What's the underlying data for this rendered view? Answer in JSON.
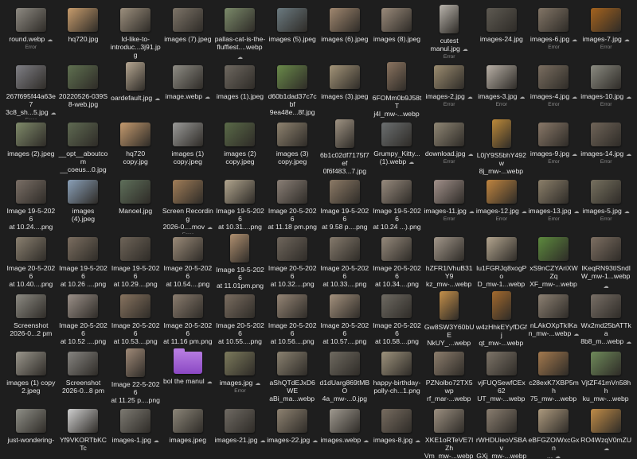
{
  "files": [
    {
      "name": "round.webp",
      "status": "Error",
      "thumb": "#8e8a82",
      "cloud": true
    },
    {
      "name": "hq720.jpg",
      "status": "",
      "thumb": "#c79c6c",
      "cloud": false
    },
    {
      "name": "Id-like-to-\nintroduc...3j91.jpg",
      "status": "",
      "thumb": "#9c8f7d",
      "cloud": false
    },
    {
      "name": "images (7).jpeg",
      "status": "",
      "thumb": "#7d7468",
      "cloud": false
    },
    {
      "name": "pallas-cat-is-the-\nfluffiest....webp",
      "status": "",
      "thumb": "#7b8a6a",
      "cloud": true
    },
    {
      "name": "images (5).jpeg",
      "status": "",
      "thumb": "#6b7a80",
      "cloud": false
    },
    {
      "name": "images (6).jpeg",
      "status": "",
      "thumb": "#a0876f",
      "cloud": false
    },
    {
      "name": "images (8).jpeg",
      "status": "",
      "thumb": "#9a8a7a",
      "cloud": false
    },
    {
      "name": "cutest\nmanul.jpg",
      "status": "Error",
      "thumb": "#b9b4ac",
      "cloud": true,
      "tall": true
    },
    {
      "name": "images-24.jpg",
      "status": "",
      "thumb": "#5e5a52",
      "cloud": false
    },
    {
      "name": "images-6.jpg",
      "status": "Error",
      "thumb": "#827566",
      "cloud": true
    },
    {
      "name": "images-7.jpg",
      "status": "Error",
      "thumb": "#a5631e",
      "cloud": true
    },
    {
      "name": "267f695f44a63e7\n3c8_sh...5.jpg",
      "status": "Error",
      "thumb": "#7f7f85",
      "cloud": true
    },
    {
      "name": "20220526-039S\n8-web.jpg",
      "status": "",
      "thumb": "#5f7050",
      "cloud": false
    },
    {
      "name": "oardefault.jpg",
      "status": "",
      "thumb": "#b6a792",
      "cloud": true,
      "tall": true
    },
    {
      "name": "image.webp",
      "status": "",
      "thumb": "#8e8c84",
      "cloud": true
    },
    {
      "name": "images (1).jpeg",
      "status": "",
      "thumb": "#6e6860",
      "cloud": false
    },
    {
      "name": "d60b1dad37c7cbf\n9ea48e...8f.jpg",
      "status": "",
      "thumb": "#6a8a4a",
      "cloud": false
    },
    {
      "name": "images (3).jpeg",
      "status": "",
      "thumb": "#a39478",
      "cloud": false
    },
    {
      "name": "6FOMm0b9J58tT\nj4l_mw-...webp",
      "status": "Error",
      "thumb": "#8b7460",
      "cloud": true,
      "tall": true
    },
    {
      "name": "images-2.jpg",
      "status": "Error",
      "thumb": "#9b8c70",
      "cloud": true
    },
    {
      "name": "images-3.jpg",
      "status": "Error",
      "thumb": "#b8b0a6",
      "cloud": true
    },
    {
      "name": "images-4.jpg",
      "status": "Error",
      "thumb": "#7a6e60",
      "cloud": true
    },
    {
      "name": "images-10.jpg",
      "status": "Error",
      "thumb": "#8a8a80",
      "cloud": true
    },
    {
      "name": "images (2).jpeg",
      "status": "",
      "thumb": "#7f8a6a",
      "cloud": false
    },
    {
      "name": "__opt__aboutcom\n__coeus...0.jpg",
      "status": "",
      "thumb": "#5f6a52",
      "cloud": false
    },
    {
      "name": "hq720\ncopy.jpg",
      "status": "",
      "thumb": "#c49a6e",
      "cloud": false
    },
    {
      "name": "images (1)\ncopy.jpeg",
      "status": "",
      "thumb": "#9a9a98",
      "cloud": false
    },
    {
      "name": "images (2)\ncopy.jpeg",
      "status": "",
      "thumb": "#5a6a48",
      "cloud": false
    },
    {
      "name": "images (3)\ncopy.jpeg",
      "status": "",
      "thumb": "#8e826f",
      "cloud": false
    },
    {
      "name": "6b1c02df7175f7ef\n0f6f483...7.jpg",
      "status": "",
      "thumb": "#9f9383",
      "cloud": false,
      "tall": true
    },
    {
      "name": "Grumpy_Kitty...\n(1).webp",
      "status": "",
      "thumb": "#6b6f70",
      "cloud": true
    },
    {
      "name": "download.jpg",
      "status": "Error",
      "thumb": "#8f8674",
      "cloud": true
    },
    {
      "name": "L0jY9S5bhY492w\n8j_mw-...webp",
      "status": "",
      "thumb": "#bd8a3a",
      "cloud": true,
      "tall": true
    },
    {
      "name": "images-9.jpg",
      "status": "Error",
      "thumb": "#897868",
      "cloud": true
    },
    {
      "name": "images-14.jpg",
      "status": "Error",
      "thumb": "#6f6458",
      "cloud": true
    },
    {
      "name": "Image 19-5-2026\nat 10.24....png",
      "status": "",
      "thumb": "#7a6f66",
      "cloud": false
    },
    {
      "name": "images\n(4).jpeg",
      "status": "",
      "thumb": "#8aa0b8",
      "cloud": false
    },
    {
      "name": "Manoel.jpg",
      "status": "",
      "thumb": "#5e6f5a",
      "cloud": false
    },
    {
      "name": "Screen Recording\n2026-0....mov",
      "status": "Error",
      "thumb": "#a07d58",
      "cloud": true
    },
    {
      "name": "Image 19-5-2026\nat 10.31....png",
      "status": "",
      "thumb": "#b1a58e",
      "cloud": false
    },
    {
      "name": "Image 20-5-2026\nat 11.18 pm.png",
      "status": "",
      "thumb": "#8a7f76",
      "cloud": false
    },
    {
      "name": "Image 19-5-2026\nat 9.58 p....png",
      "status": "",
      "thumb": "#8c7a66",
      "cloud": false
    },
    {
      "name": "Image 19-5-2026\nat 10.24 ...).png",
      "status": "",
      "thumb": "#978a7d",
      "cloud": false
    },
    {
      "name": "images-11.jpg",
      "status": "Error",
      "thumb": "#a1908a",
      "cloud": true
    },
    {
      "name": "images-12.jpg",
      "status": "Error",
      "thumb": "#c08540",
      "cloud": true
    },
    {
      "name": "images-13.jpg",
      "status": "Error",
      "thumb": "#8b7f6a",
      "cloud": true
    },
    {
      "name": "images-5.jpg",
      "status": "Error",
      "thumb": "#76705f",
      "cloud": true
    },
    {
      "name": "Image 20-5-2026\nat 10.40....png",
      "status": "",
      "thumb": "#8a8070",
      "cloud": false
    },
    {
      "name": "Image 19-5-2026\nat 10.26 ....png",
      "status": "",
      "thumb": "#7b6e60",
      "cloud": false
    },
    {
      "name": "Image 19-5-2026\nat 10.29....png",
      "status": "",
      "thumb": "#6e6458",
      "cloud": false
    },
    {
      "name": "Image 20-5-2026\nat 10.54....png",
      "status": "",
      "thumb": "#9a8a78",
      "cloud": false
    },
    {
      "name": "Image 19-5-2026\nat 11.01pm.png",
      "status": "",
      "thumb": "#b09070",
      "cloud": false,
      "tall": true
    },
    {
      "name": "Image 20-5-2026\nat 10.32....png",
      "status": "",
      "thumb": "#6f665c",
      "cloud": false
    },
    {
      "name": "Image 20-5-2026\nat 10.33....png",
      "status": "",
      "thumb": "#857a6c",
      "cloud": false
    },
    {
      "name": "Image 20-5-2026\nat 10.34....png",
      "status": "",
      "thumb": "#95897b",
      "cloud": false
    },
    {
      "name": "hZFR1lVhuB31Y9\nkz_mw-...webp",
      "status": "",
      "thumb": "#a2978a",
      "cloud": true
    },
    {
      "name": "lu1FGRJq8xogPo\nD_mw-1...webp",
      "status": "",
      "thumb": "#b3a58f",
      "cloud": true
    },
    {
      "name": "xS9nCZYAriXWZq\nXF_mw-...webp",
      "status": "",
      "thumb": "#5d8a3e",
      "cloud": true
    },
    {
      "name": "lKeqRN93tISndl\nW_mw-1...webp",
      "status": "",
      "thumb": "#7d6f62",
      "cloud": true
    },
    {
      "name": "Screenshot\n2026-0...2 pm",
      "status": "",
      "thumb": "#8c8a82",
      "cloud": false
    },
    {
      "name": "Image 20-5-2026\nat 10.52 ....png",
      "status": "",
      "thumb": "#9b9088",
      "cloud": false
    },
    {
      "name": "Image 20-5-2026\nat 10.53....png",
      "status": "",
      "thumb": "#87735f",
      "cloud": false
    },
    {
      "name": "Image 20-5-2026\nat 11.16 pm.png",
      "status": "",
      "thumb": "#8a7c6e",
      "cloud": false
    },
    {
      "name": "Image 20-5-2026\nat 10.55....png",
      "status": "",
      "thumb": "#7a6d60",
      "cloud": false
    },
    {
      "name": "Image 20-5-2026\nat 10.56....png",
      "status": "",
      "thumb": "#958575",
      "cloud": false
    },
    {
      "name": "Image 20-5-2026\nat 10.57....png",
      "status": "",
      "thumb": "#a4917d",
      "cloud": false
    },
    {
      "name": "Image 20-5-2026\nat 10.58....png",
      "status": "",
      "thumb": "#6e6a62",
      "cloud": false
    },
    {
      "name": "Gw8SW3Y60bUE\nNkUY_...webp",
      "status": "",
      "thumb": "#c5904a",
      "cloud": true,
      "tall": true
    },
    {
      "name": "w4zHhkEYyfDGfj\nqt_mw-...webp",
      "status": "",
      "thumb": "#a46a2e",
      "cloud": true,
      "tall": true
    },
    {
      "name": "nLAkOXpTkIKa\nn_mw-...webp",
      "status": "",
      "thumb": "#8c8072",
      "cloud": true
    },
    {
      "name": "Wx2md25bATTka\n8b8_m...webp",
      "status": "",
      "thumb": "#786f66",
      "cloud": true
    },
    {
      "name": "images (1) copy\n2.jpeg",
      "status": "",
      "thumb": "#9a968c",
      "cloud": false
    },
    {
      "name": "Screenshot\n2026-0...8 pm",
      "status": "",
      "thumb": "#868480",
      "cloud": false
    },
    {
      "name": "Image 22-5-2026\nat 11.25 p....png",
      "status": "",
      "thumb": "#a08a78",
      "cloud": false,
      "tall": true
    },
    {
      "name": "bol the manul",
      "status": "",
      "thumb": "folder",
      "cloud": true
    },
    {
      "name": "images.jpg",
      "status": "Error",
      "thumb": "#7c7a5c",
      "cloud": true
    },
    {
      "name": "aShQTdEJxD6WE\naBi_ma...webp",
      "status": "",
      "thumb": "#8a8170",
      "cloud": true
    },
    {
      "name": "d1dUarg869tMBO\n4a_mw-...0.jpg",
      "status": "",
      "thumb": "#6f6a60",
      "cloud": false
    },
    {
      "name": "happy-birthday-\npolly-ch...1.png",
      "status": "",
      "thumb": "#9d927c",
      "cloud": false
    },
    {
      "name": "PZNolbo72TX5wp\nrf_mar-...webp",
      "status": "",
      "thumb": "#8c7d6c",
      "cloud": true
    },
    {
      "name": "vjFUQSewfCEx62\nUT_mw-...webp",
      "status": "",
      "thumb": "#7d7468",
      "cloud": true
    },
    {
      "name": "c28exK7XBP5mh\n75_mw-...webp",
      "status": "",
      "thumb": "#a3794e",
      "cloud": true
    },
    {
      "name": "VjtZF41mVn58hh\nku_mw-...webp",
      "status": "",
      "thumb": "#6f8a5a",
      "cloud": true
    },
    {
      "name": "just-wondering-",
      "status": "",
      "thumb": "#8f8f87",
      "cloud": false
    },
    {
      "name": "Yf9VKORTbKCTc",
      "status": "",
      "thumb": "#cfcfcf",
      "cloud": false
    },
    {
      "name": "images-1.jpg",
      "status": "",
      "thumb": "#7d7a72",
      "cloud": true
    },
    {
      "name": "images.jpeg",
      "status": "",
      "thumb": "#8b8578",
      "cloud": false
    },
    {
      "name": "images-21.jpg",
      "status": "",
      "thumb": "#6f6a63",
      "cloud": true
    },
    {
      "name": "images-22.jpg",
      "status": "",
      "thumb": "#8e8271",
      "cloud": true
    },
    {
      "name": "images.webp",
      "status": "",
      "thumb": "#a09a90",
      "cloud": true
    },
    {
      "name": "images-8.jpg",
      "status": "",
      "thumb": "#776c60",
      "cloud": true
    },
    {
      "name": "XKE1oRTeVE7IZh\nVm_mw-...webp",
      "status": "",
      "thumb": "#9b8f80",
      "cloud": true
    },
    {
      "name": "rWHDUieoVSBAv\nGXj_mw-...webp",
      "status": "",
      "thumb": "#8a7e70",
      "cloud": true
    },
    {
      "name": "eBFGZOiWxcGxn\n...",
      "status": "",
      "thumb": "#ad9a7e",
      "cloud": true
    },
    {
      "name": "RO4WzqV0mZU",
      "status": "",
      "thumb": "#c08c48",
      "cloud": true
    }
  ],
  "labels": {
    "cloud_icon": "cloud-icon"
  }
}
